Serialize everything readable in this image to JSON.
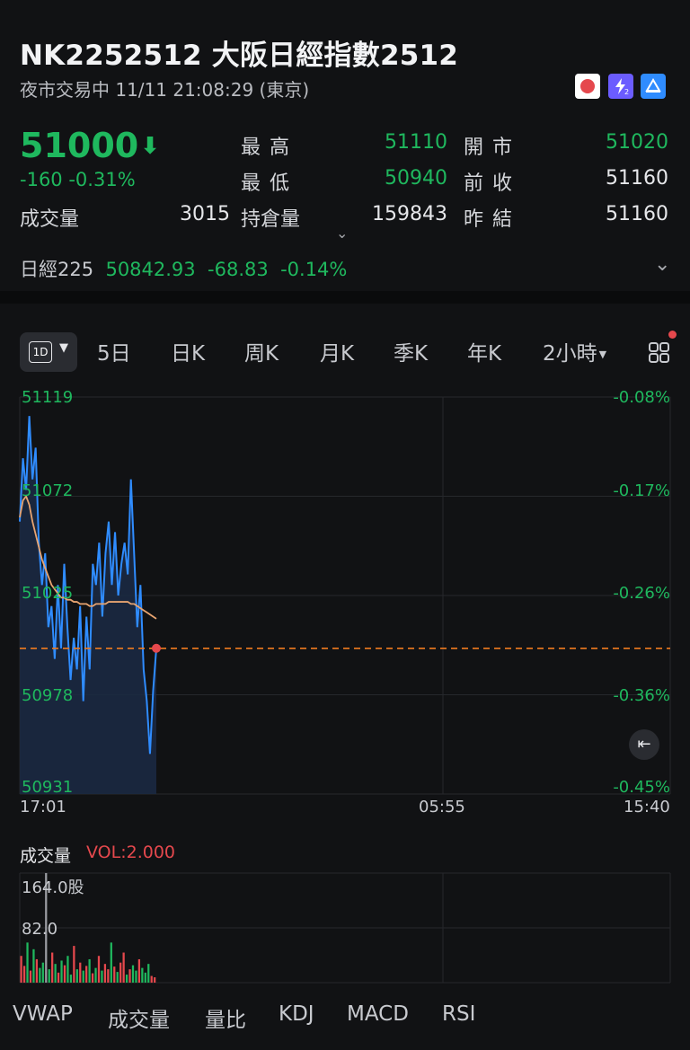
{
  "header": {
    "title": "NK2252512   大阪日經指數2512",
    "subtitle": "夜市交易中 11/11 21:08:29 (東京)",
    "badges": [
      {
        "name": "japan-flag-icon",
        "color": "#e5484d"
      },
      {
        "name": "level2-icon",
        "color": "#6b5cff"
      },
      {
        "name": "pyramid-icon",
        "color": "#2f8cff"
      }
    ]
  },
  "quote": {
    "price": "51000",
    "change": "-160",
    "change_pct": "-0.31%",
    "volume_label": "成交量",
    "volume": "3015",
    "high_label": "最高",
    "high": "51110",
    "low_label": "最低",
    "low": "50940",
    "oi_label": "持倉量",
    "oi": "159843",
    "open_label": "開市",
    "open": "51020",
    "prev_close_label": "前收",
    "prev_close": "51160",
    "prev_settle_label": "昨結",
    "prev_settle": "51160"
  },
  "index": {
    "name": "日經225",
    "value": "50842.93",
    "change": "-68.83",
    "change_pct": "-0.14%"
  },
  "tabs": {
    "range_selected": "1D",
    "items": [
      "5日",
      "日K",
      "周K",
      "月K",
      "季K",
      "年K",
      "2小時"
    ]
  },
  "chart": {
    "y_labels": [
      "51119",
      "51072",
      "51025",
      "50978",
      "50931"
    ],
    "pct_labels": [
      "-0.08%",
      "-0.17%",
      "-0.26%",
      "-0.36%",
      "-0.45%"
    ],
    "x_labels": [
      "17:01",
      "05:55",
      "15:40"
    ],
    "colors": {
      "price": "#2f8cff",
      "vwap": "#e8a470",
      "ref": "#f07b1f"
    }
  },
  "volume": {
    "title": "成交量",
    "vol_label": "VOL:2.000",
    "y_max_label": "164.0股",
    "y_mid_label": "82.0"
  },
  "chart_data": {
    "type": "line",
    "y_range": [
      50931,
      51119
    ],
    "reference_price": 51000,
    "price": [
      51060,
      51090,
      51075,
      51110,
      51080,
      51095,
      51050,
      51030,
      51045,
      51010,
      51020,
      50995,
      51030,
      51000,
      51040,
      51010,
      50985,
      51005,
      50990,
      51020,
      50975,
      51015,
      50990,
      51040,
      51030,
      51050,
      51015,
      51045,
      51060,
      51030,
      51055,
      51025,
      51040,
      51050,
      51035,
      51080,
      51045,
      51010,
      51030,
      50990,
      50975,
      50950,
      50980,
      51000
    ],
    "vwap": [
      51062,
      51070,
      51072,
      51068,
      51060,
      51054,
      51048,
      51042,
      51038,
      51034,
      51030,
      51028,
      51026,
      51024,
      51024,
      51023,
      51023,
      51022,
      51022,
      51021,
      51021,
      51021,
      51020,
      51020,
      51021,
      51021,
      51021,
      51021,
      51022,
      51022,
      51022,
      51022,
      51022,
      51022,
      51022,
      51021,
      51021,
      51020,
      51019,
      51018,
      51017,
      51016,
      51015,
      51014
    ],
    "volume": [
      40,
      25,
      60,
      18,
      50,
      35,
      22,
      30,
      164,
      20,
      45,
      28,
      15,
      33,
      26,
      40,
      12,
      55,
      20,
      30,
      18,
      25,
      35,
      14,
      22,
      40,
      18,
      28,
      20,
      60,
      24,
      16,
      30,
      45,
      12,
      20,
      26,
      18,
      35,
      22,
      15,
      28,
      10,
      8
    ]
  },
  "bottom_tabs": [
    "VWAP",
    "成交量",
    "量比",
    "KDJ",
    "MACD",
    "RSI"
  ]
}
